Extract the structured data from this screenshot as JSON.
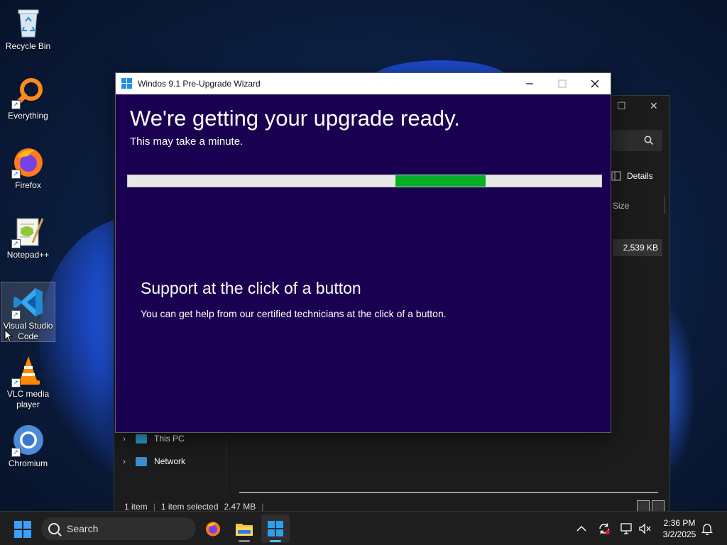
{
  "desktop": {
    "icons": [
      {
        "label": "Recycle Bin"
      },
      {
        "label": "Everything"
      },
      {
        "label": "Firefox"
      },
      {
        "label": "Notepad++"
      },
      {
        "label": "Visual Studio Code"
      },
      {
        "label": "VLC media player"
      },
      {
        "label": "Chromium"
      }
    ]
  },
  "explorer": {
    "details_label": "Details",
    "column_size": "Size",
    "file_size": "2,539 KB",
    "nav": [
      {
        "label": "This PC"
      },
      {
        "label": "Network"
      }
    ],
    "status": {
      "items": "1 item",
      "selected": "1 item selected",
      "selected_size": "2.47 MB"
    }
  },
  "wizard": {
    "title": "Windos 9.1 Pre-Upgrade Wizard",
    "heading": "We're getting your upgrade ready.",
    "subheading": "This may take a minute.",
    "progress": {
      "segment_start_fraction": 0.565,
      "segment_end_fraction": 0.755
    },
    "support_title": "Support at the click of a button",
    "support_text": "You can get help from our certified technicians at the click of a button.",
    "colors": {
      "background": "#1a0050",
      "progress_fill": "#06b025"
    }
  },
  "taskbar": {
    "search_label": "Search",
    "time": "2:36 PM",
    "date": "3/2/2025"
  }
}
